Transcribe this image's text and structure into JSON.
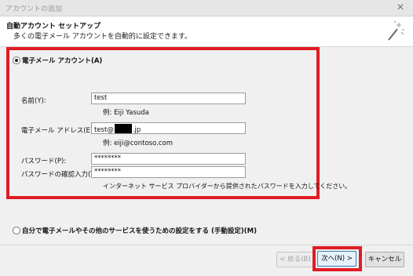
{
  "window": {
    "title": "アカウントの追加",
    "close_label": "✕"
  },
  "header": {
    "title": "自動アカウント セットアップ",
    "subtitle": "多くの電子メール アカウントを自動的に設定できます。"
  },
  "email_account": {
    "option_label": "電子メール アカウント(A)",
    "name_label": "名前(Y):",
    "name_value": "test",
    "name_example": "例: Eiji Yasuda",
    "email_label": "電子メール アドレス(E):",
    "email_value_prefix": "test@",
    "email_value_suffix": ".jp",
    "email_example": "例: eiji@contoso.com",
    "password_label": "パスワード(P):",
    "password_value": "********",
    "password_confirm_label": "パスワードの確認入力(T):",
    "password_confirm_value": "********",
    "password_hint": "インターネット サービス プロバイダーから提供されたパスワードを入力してください。"
  },
  "manual": {
    "option_label": "自分で電子メールやその他のサービスを使うための設定をする (手動設定)(M)"
  },
  "buttons": {
    "back": "< 戻る(B)",
    "next": "次へ(N) >",
    "cancel": "キャンセル"
  },
  "highlight": {
    "color": "#e01c24"
  }
}
